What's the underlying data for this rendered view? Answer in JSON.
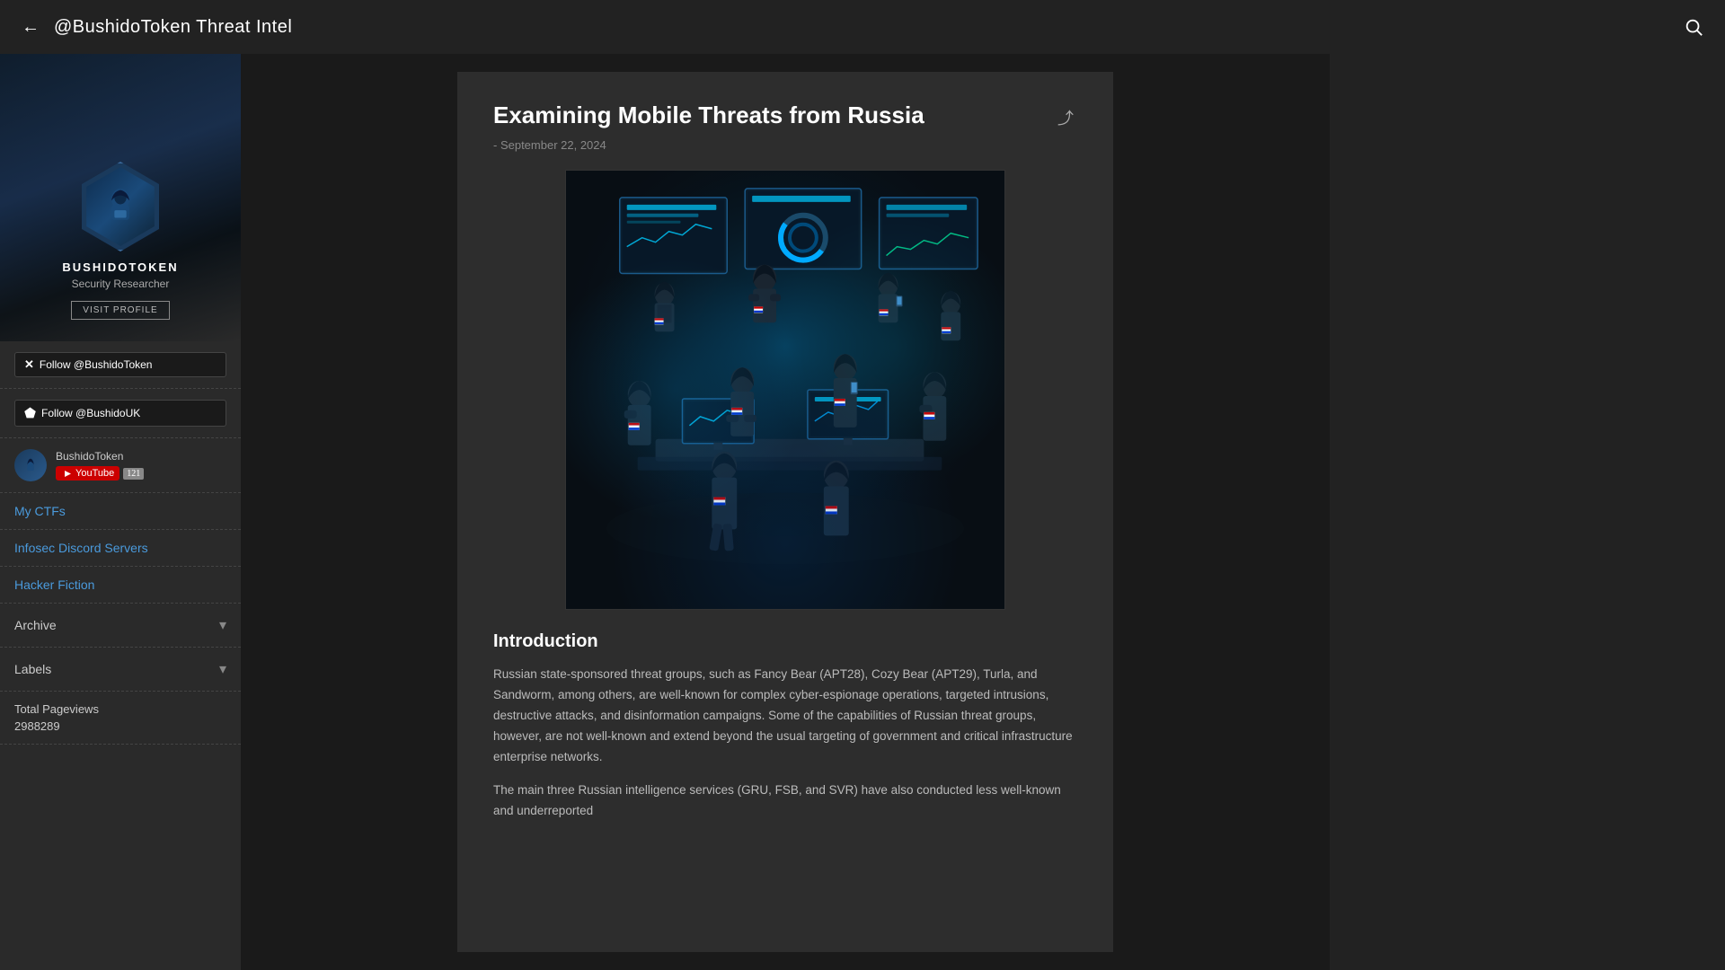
{
  "header": {
    "back_label": "←",
    "title": "@BushidoToken Threat Intel",
    "search_label": "🔍"
  },
  "sidebar": {
    "username": "BUSHIDOTOKEN",
    "subtitle": "Security Researcher",
    "visit_profile_label": "VISIT PROFILE",
    "avatar_label": "BUSHIDO",
    "social": {
      "twitter_label": "Follow @BushidoToken",
      "github_label": "Follow @BushidoUK",
      "youtube_channel": "BushidoToken",
      "youtube_subscribers": "121"
    },
    "nav_items": [
      {
        "id": "ctfs",
        "label": "My CTFs"
      },
      {
        "id": "discord",
        "label": "Infosec Discord Servers"
      },
      {
        "id": "fiction",
        "label": "Hacker Fiction"
      }
    ],
    "sections": [
      {
        "id": "archive",
        "label": "Archive"
      },
      {
        "id": "labels",
        "label": "Labels"
      }
    ],
    "pageviews_label": "Total Pageviews",
    "pageviews_count": "2988289"
  },
  "article": {
    "title": "Examining Mobile Threats from Russia",
    "date": "- September 22, 2024",
    "share_label": "⤴",
    "image_alt": "Cyber soldiers at computer terminals",
    "section_intro": "Introduction",
    "body_paragraphs": [
      "Russian state-sponsored threat groups, such as Fancy Bear (APT28), Cozy Bear (APT29), Turla, and Sandworm, among others, are well-known for complex cyber-espionage operations, targeted intrusions, destructive attacks, and disinformation campaigns. Some of the capabilities of Russian threat groups, however, are not well-known and extend beyond the usual targeting of government and critical infrastructure enterprise networks.",
      "The main three Russian intelligence services (GRU, FSB, and SVR) have also conducted less well-known and underreported"
    ]
  }
}
